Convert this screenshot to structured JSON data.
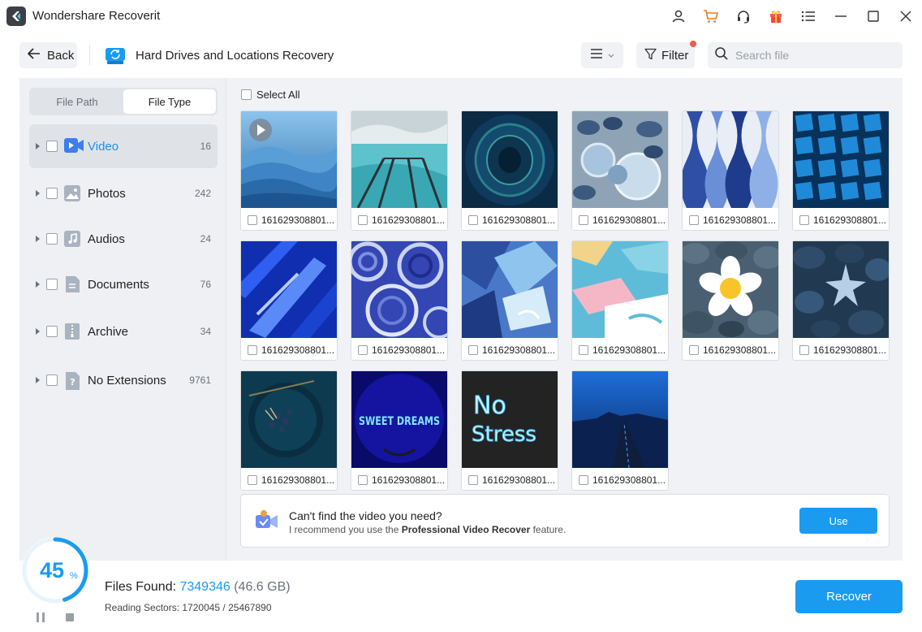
{
  "titlebar": {
    "app_title": "Wondershare Recoverit",
    "icons": [
      "user-icon",
      "cart-icon",
      "headset-icon",
      "gift-icon",
      "menu-icon",
      "minimize-icon",
      "maximize-icon",
      "close-icon"
    ]
  },
  "header": {
    "back_label": "Back",
    "location_title": "Hard Drives and Locations Recovery",
    "filter_label": "Filter",
    "search_placeholder": "Search file"
  },
  "sidebar": {
    "tabs": [
      {
        "label": "File Path",
        "active": false
      },
      {
        "label": "File Type",
        "active": true
      }
    ],
    "categories": [
      {
        "label": "Video",
        "count": "16",
        "icon": "video-icon",
        "selected": true
      },
      {
        "label": "Photos",
        "count": "242",
        "icon": "photo-icon",
        "selected": false
      },
      {
        "label": "Audios",
        "count": "24",
        "icon": "audio-icon",
        "selected": false
      },
      {
        "label": "Documents",
        "count": "76",
        "icon": "document-icon",
        "selected": false
      },
      {
        "label": "Archive",
        "count": "34",
        "icon": "archive-icon",
        "selected": false
      },
      {
        "label": "No Extensions",
        "count": "9761",
        "icon": "unknown-file-icon",
        "selected": false
      }
    ]
  },
  "content": {
    "select_all_label": "Select All",
    "files": [
      {
        "name": "161629308801..."
      },
      {
        "name": "161629308801..."
      },
      {
        "name": "161629308801..."
      },
      {
        "name": "161629308801..."
      },
      {
        "name": "161629308801..."
      },
      {
        "name": "161629308801..."
      },
      {
        "name": "161629308801..."
      },
      {
        "name": "161629308801..."
      },
      {
        "name": "161629308801..."
      },
      {
        "name": "161629308801..."
      },
      {
        "name": "161629308801..."
      },
      {
        "name": "161629308801..."
      },
      {
        "name": "161629308801..."
      },
      {
        "name": "161629308801..."
      },
      {
        "name": "161629308801..."
      },
      {
        "name": "161629308801..."
      }
    ],
    "thumb_texts": {
      "sweet_dreams": "SWEET DREAMS",
      "no": "No",
      "stress": "Stress"
    }
  },
  "banner": {
    "title": "Can't find the video you need?",
    "sub_prefix": "I recommend you use the ",
    "sub_bold": "Professional Video Recover",
    "sub_suffix": " feature.",
    "use_label": "Use"
  },
  "footer": {
    "progress_number": "45",
    "progress_unit": "%",
    "progress_value": 45,
    "files_found_label": "Files Found: ",
    "files_found_count": "7349346",
    "files_found_size": " (46.6 GB)",
    "reading_sectors": "Reading Sectors: 1720045 / 25467890",
    "recover_label": "Recover"
  },
  "colors": {
    "accent": "#1a9bf0",
    "notification_dot": "#f25b4a"
  }
}
